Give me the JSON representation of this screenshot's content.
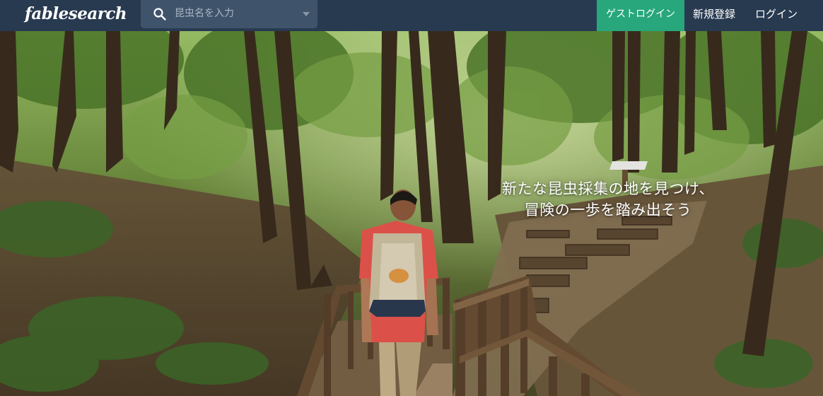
{
  "header": {
    "brand": "fablesearch",
    "search": {
      "placeholder": "昆虫名を入力",
      "value": ""
    },
    "guest_login": "ゲストログイン",
    "register": "新規登録",
    "login": "ログイン",
    "colors": {
      "navbar": "#283a50",
      "search_bg": "#3f546b",
      "accent": "#27a77b"
    }
  },
  "hero": {
    "tagline_line1": "新たな昆虫採集の地を見つけ、",
    "tagline_line2": "冒険の一歩を踏み出そう",
    "photo_subject": "hiker with backpack on wooden bridge in forest"
  },
  "icons": {
    "search": "search-icon",
    "dropdown": "chevron-down-icon"
  }
}
